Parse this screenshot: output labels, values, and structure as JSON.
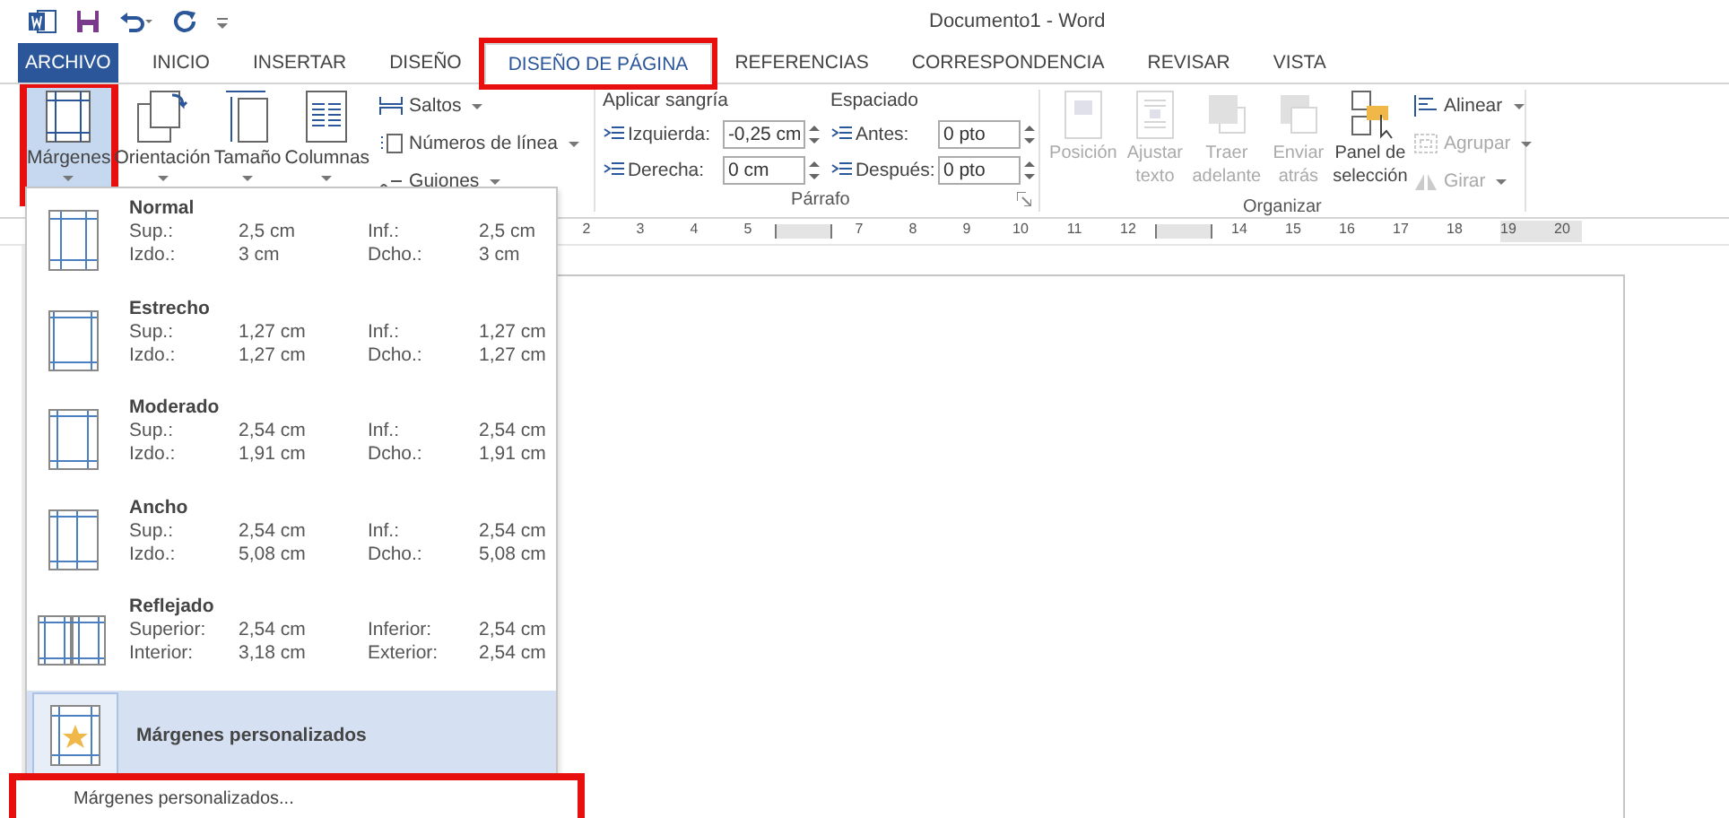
{
  "window": {
    "title": "Documento1 - Word"
  },
  "tabs": [
    {
      "label": "ARCHIVO",
      "kind": "file",
      "selected": false,
      "highlighted": false
    },
    {
      "label": "INICIO",
      "kind": "tab",
      "selected": false,
      "highlighted": false
    },
    {
      "label": "INSERTAR",
      "kind": "tab",
      "selected": false,
      "highlighted": false
    },
    {
      "label": "DISEÑO",
      "kind": "tab",
      "selected": false,
      "highlighted": false
    },
    {
      "label": "DISEÑO DE PÁGINA",
      "kind": "tab",
      "selected": true,
      "highlighted": true
    },
    {
      "label": "REFERENCIAS",
      "kind": "tab",
      "selected": false,
      "highlighted": false
    },
    {
      "label": "CORRESPONDENCIA",
      "kind": "tab",
      "selected": false,
      "highlighted": false
    },
    {
      "label": "REVISAR",
      "kind": "tab",
      "selected": false,
      "highlighted": false
    },
    {
      "label": "VISTA",
      "kind": "tab",
      "selected": false,
      "highlighted": false
    }
  ],
  "page_setup": {
    "large_buttons": [
      {
        "label": "Márgenes",
        "kind": "margins",
        "selected": true,
        "highlighted": true
      },
      {
        "label": "Orientación",
        "kind": "orientation",
        "selected": false,
        "highlighted": false
      },
      {
        "label": "Tamaño",
        "kind": "size",
        "selected": false,
        "highlighted": false
      },
      {
        "label": "Columnas",
        "kind": "columns",
        "selected": false,
        "highlighted": false
      }
    ],
    "small_buttons": [
      {
        "label": "Saltos",
        "kind": "breaks"
      },
      {
        "label": "Números de línea",
        "kind": "lines"
      },
      {
        "label": "Guiones",
        "kind": "hyphen"
      }
    ]
  },
  "paragraph": {
    "label": "Párrafo",
    "indent": {
      "heading": "Aplicar sangría",
      "fields": [
        {
          "label": "Izquierda:",
          "value": "-0,25 cm"
        },
        {
          "label": "Derecha:",
          "value": "0 cm"
        }
      ]
    },
    "spacing": {
      "heading": "Espaciado",
      "fields": [
        {
          "label": "Antes:",
          "value": "0 pto"
        },
        {
          "label": "Después:",
          "value": "0 pto"
        }
      ]
    }
  },
  "arrange": {
    "label": "Organizar",
    "large_buttons": [
      {
        "label": "Posición",
        "kind": "position",
        "disabled": true
      },
      {
        "label": "Ajustar texto",
        "kind": "wrap",
        "disabled": true
      },
      {
        "label": "Traer adelante",
        "kind": "forward",
        "disabled": true
      },
      {
        "label": "Enviar atrás",
        "kind": "backward",
        "disabled": true
      },
      {
        "label": "Panel de selección",
        "kind": "pane",
        "disabled": false
      }
    ],
    "small_buttons": [
      {
        "label": "Alinear",
        "kind": "align",
        "disabled": false
      },
      {
        "label": "Agrupar",
        "kind": "group",
        "disabled": true
      },
      {
        "label": "Girar",
        "kind": "rotate",
        "disabled": true
      }
    ]
  },
  "ruler": [
    {
      "kind": "number",
      "label": "2"
    },
    {
      "kind": "number",
      "label": "3"
    },
    {
      "kind": "number",
      "label": "4"
    },
    {
      "kind": "number",
      "label": "5"
    },
    {
      "kind": "marker"
    },
    {
      "kind": "number",
      "label": "7"
    },
    {
      "kind": "number",
      "label": "8"
    },
    {
      "kind": "number",
      "label": "9"
    },
    {
      "kind": "number",
      "label": "10"
    },
    {
      "kind": "number",
      "label": "11"
    },
    {
      "kind": "number",
      "label": "12"
    },
    {
      "kind": "marker"
    },
    {
      "kind": "number",
      "label": "14"
    },
    {
      "kind": "number",
      "label": "15"
    },
    {
      "kind": "number",
      "label": "16"
    },
    {
      "kind": "number",
      "label": "17"
    },
    {
      "kind": "number",
      "label": "18"
    },
    {
      "kind": "number",
      "label": "19"
    },
    {
      "kind": "number",
      "label": "20"
    }
  ],
  "margins_menu": {
    "presets": [
      {
        "name": "Normal",
        "kind": "single",
        "rows": [
          [
            "Sup.:",
            "2,5 cm",
            "Inf.:",
            "2,5 cm"
          ],
          [
            "Izdo.:",
            "3 cm",
            "Dcho.:",
            "3 cm"
          ]
        ]
      },
      {
        "name": "Estrecho",
        "kind": "single",
        "rows": [
          [
            "Sup.:",
            "1,27 cm",
            "Inf.:",
            "1,27 cm"
          ],
          [
            "Izdo.:",
            "1,27 cm",
            "Dcho.:",
            "1,27 cm"
          ]
        ]
      },
      {
        "name": "Moderado",
        "kind": "single",
        "rows": [
          [
            "Sup.:",
            "2,54 cm",
            "Inf.:",
            "2,54 cm"
          ],
          [
            "Izdo.:",
            "1,91 cm",
            "Dcho.:",
            "1,91 cm"
          ]
        ]
      },
      {
        "name": "Ancho",
        "kind": "single",
        "rows": [
          [
            "Sup.:",
            "2,54 cm",
            "Inf.:",
            "2,54 cm"
          ],
          [
            "Izdo.:",
            "5,08 cm",
            "Dcho.:",
            "5,08 cm"
          ]
        ]
      },
      {
        "name": "Reflejado",
        "kind": "facing",
        "rows": [
          [
            "Superior:",
            "2,54 cm",
            "Inferior:",
            "2,54 cm"
          ],
          [
            "Interior:",
            "3,18 cm",
            "Exterior:",
            "2,54 cm"
          ]
        ]
      }
    ],
    "custom": {
      "name": "Márgenes personalizados",
      "selected": true
    },
    "footer": {
      "label": "Márgenes personalizados...",
      "highlighted": true
    }
  }
}
